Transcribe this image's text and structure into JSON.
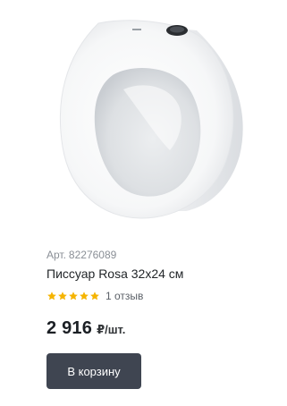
{
  "product": {
    "image_icon": "urinal-product-image",
    "sku_prefix": "Арт.",
    "sku": "82276089",
    "title": "Писсуар Rosa 32x24 см",
    "rating": 5,
    "rating_max": 5,
    "reviews_label": "1 отзыв",
    "price": "2 916",
    "price_unit": "₽/шт.",
    "add_to_cart_label": "В корзину"
  },
  "colors": {
    "star": "#f5b400",
    "button_bg": "#3f4551",
    "button_text": "#ffffff",
    "sku_text": "#8a8f96"
  }
}
